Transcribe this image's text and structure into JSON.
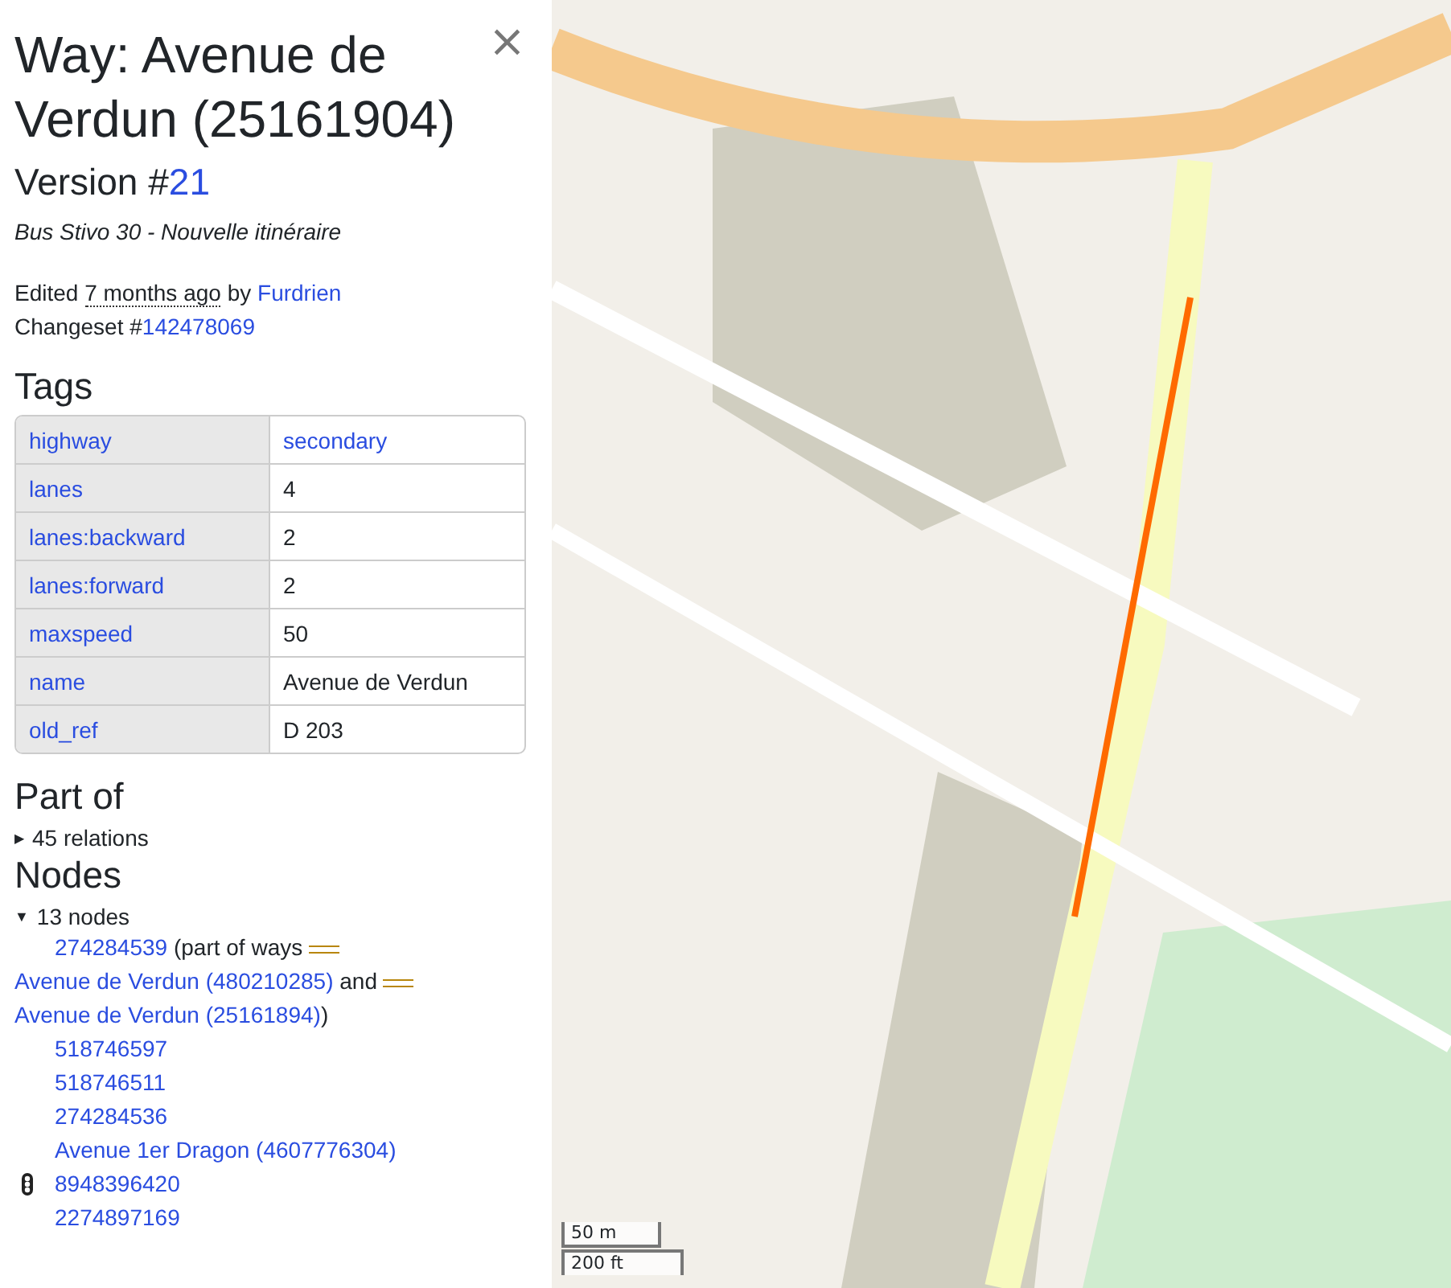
{
  "sidebar": {
    "title": "Way: Avenue de Verdun (25161904)",
    "close": "×",
    "version_label": "Version #",
    "version": "21",
    "comment": "Bus Stivo 30 - Nouvelle itinéraire",
    "edited": {
      "prefix": "Edited",
      "time": "7 months ago",
      "by": "by",
      "user": "Furdrien"
    },
    "changeset": {
      "label": "Changeset #",
      "id": "142478069"
    },
    "tags_heading": "Tags",
    "tags": [
      {
        "key": "highway",
        "value": "secondary",
        "value_link": true
      },
      {
        "key": "lanes",
        "value": "4",
        "value_link": false
      },
      {
        "key": "lanes:backward",
        "value": "2",
        "value_link": false
      },
      {
        "key": "lanes:forward",
        "value": "2",
        "value_link": false
      },
      {
        "key": "maxspeed",
        "value": "50",
        "value_link": false
      },
      {
        "key": "name",
        "value": "Avenue de Verdun",
        "value_link": false
      },
      {
        "key": "old_ref",
        "value": "D 203",
        "value_link": false
      }
    ],
    "part_of": {
      "heading": "Part of",
      "marker": "▶",
      "summary": "45 relations",
      "expanded": false
    },
    "nodes": {
      "heading": "Nodes",
      "marker": "▼",
      "summary": "13 nodes",
      "expanded": true,
      "items": [
        {
          "kind": "plain",
          "parts": [
            {
              "kind": "link",
              "text": "274284539"
            },
            {
              "kind": "text",
              "text": " (part of ways "
            },
            {
              "kind": "way",
              "text": "Avenue de Verdun (480210285)"
            },
            {
              "kind": "text",
              "text": " and "
            },
            {
              "kind": "way",
              "text": "Avenue de Verdun (25161894)"
            },
            {
              "kind": "text",
              "text": ")"
            }
          ]
        },
        {
          "kind": "plain",
          "parts": [
            {
              "kind": "link",
              "text": "518746597"
            }
          ]
        },
        {
          "kind": "plain",
          "parts": [
            {
              "kind": "link",
              "text": "518746511"
            }
          ]
        },
        {
          "kind": "plain",
          "parts": [
            {
              "kind": "link",
              "text": "274284536"
            }
          ]
        },
        {
          "kind": "plain",
          "parts": [
            {
              "kind": "link",
              "text": "Avenue 1er Dragon (4607776304)"
            }
          ]
        },
        {
          "kind": "traffic_signals",
          "parts": [
            {
              "kind": "link",
              "text": "8948396420"
            }
          ]
        },
        {
          "kind": "plain",
          "parts": [
            {
              "kind": "link",
              "text": "2274897169"
            }
          ]
        }
      ]
    }
  },
  "map": {
    "scale": [
      "50 m",
      "200 ft"
    ]
  }
}
